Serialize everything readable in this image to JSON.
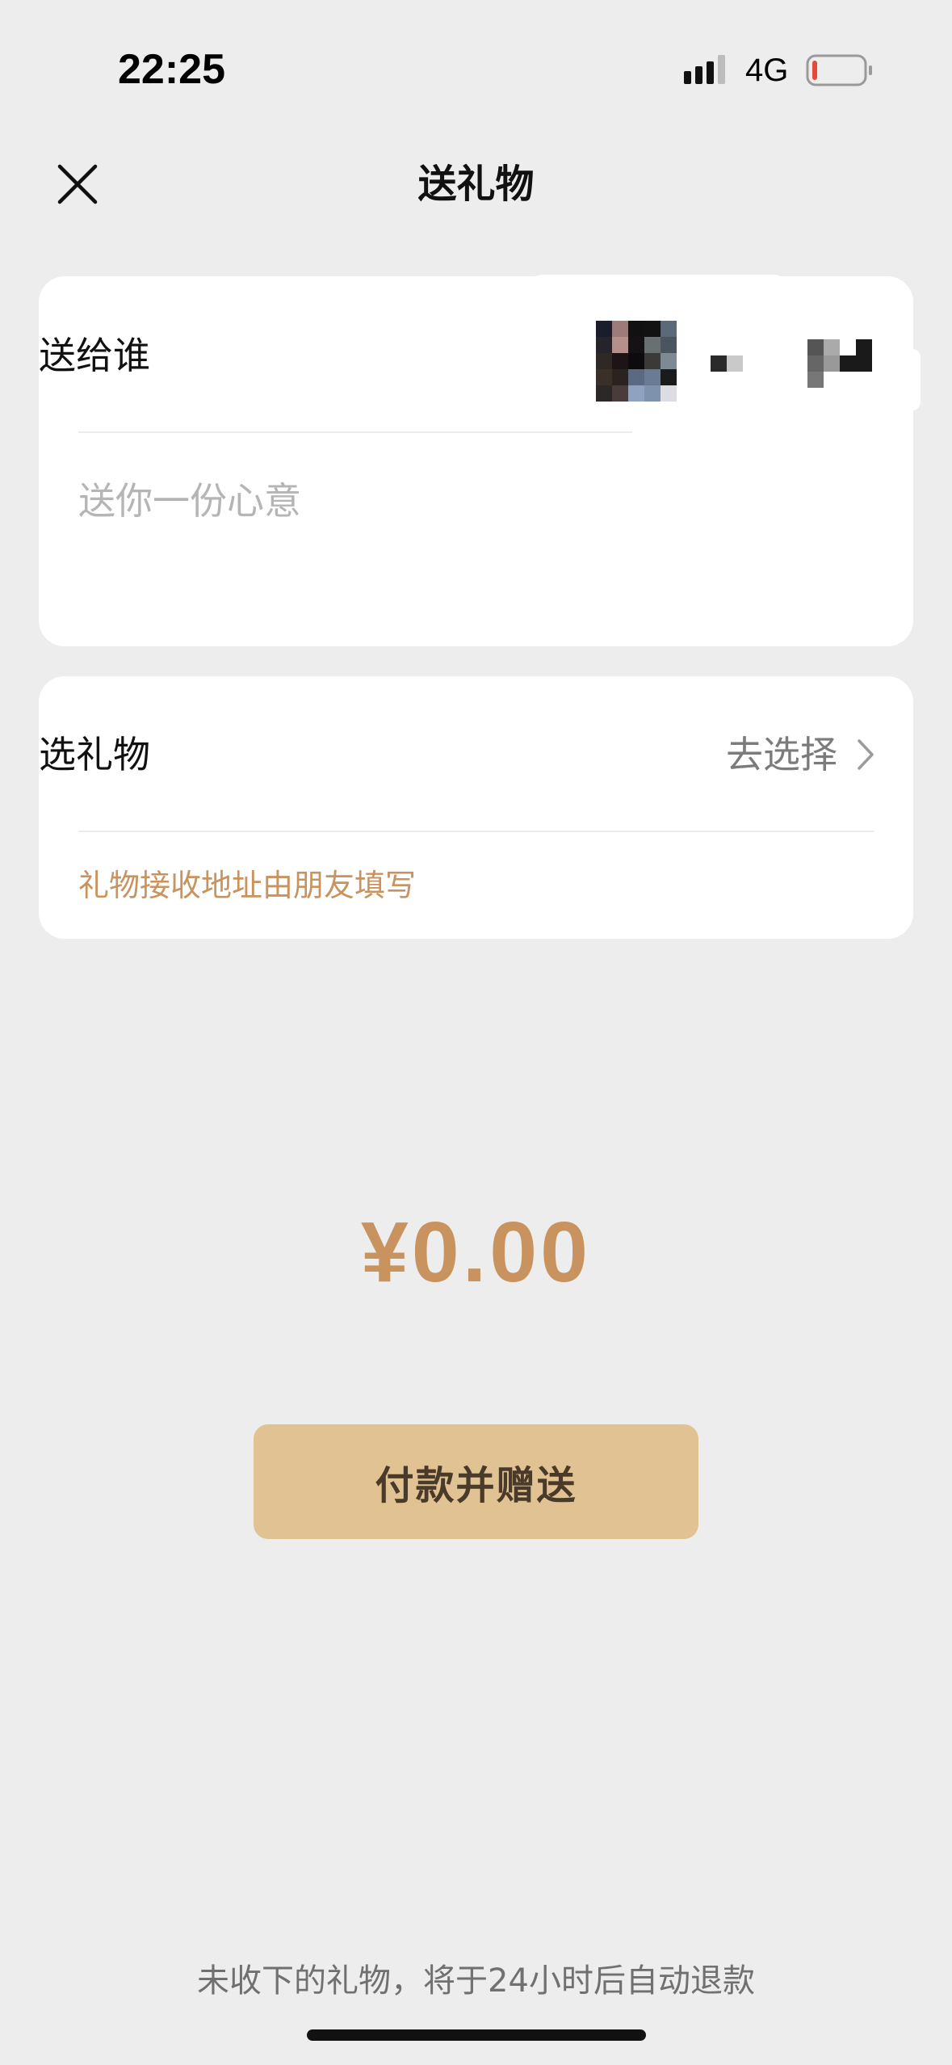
{
  "status_bar": {
    "time": "22:25",
    "network": "4G",
    "battery_level": 0.08,
    "battery_color": "#e24a3b"
  },
  "nav": {
    "title": "送礼物",
    "close_icon": "close-icon"
  },
  "recipient_card": {
    "label": "送给谁",
    "message_placeholder": "送你一份心意",
    "message_value": ""
  },
  "gift_card": {
    "label": "选礼物",
    "choose_label": "去选择",
    "address_note": "礼物接收地址由朋友填写"
  },
  "amount": "¥0.00",
  "pay_button_label": "付款并赠送",
  "refund_note": "未收下的礼物，将于24小时后自动退款",
  "colors": {
    "background": "#ededed",
    "card": "#ffffff",
    "accent": "#c8935f",
    "button": "#e1c293",
    "button_text": "#4a3a2a"
  }
}
